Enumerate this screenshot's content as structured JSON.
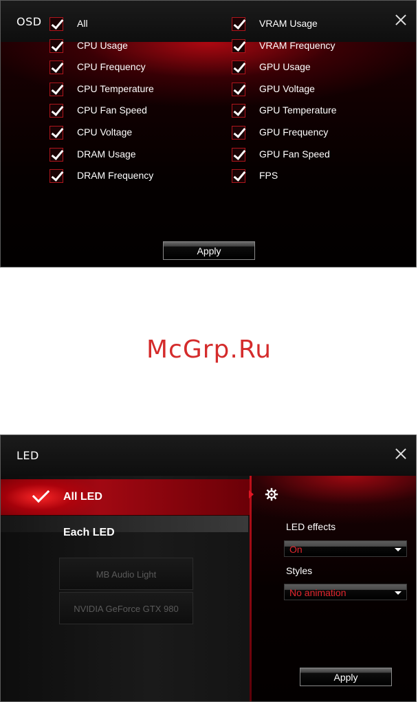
{
  "osd": {
    "title": "OSD",
    "left_items": [
      "All",
      "CPU Usage",
      "CPU Frequency",
      "CPU Temperature",
      "CPU Fan Speed",
      "CPU Voltage",
      "DRAM Usage",
      "DRAM Frequency"
    ],
    "right_items": [
      "VRAM Usage",
      "VRAM Frequency",
      "GPU Usage",
      "GPU Voltage",
      "GPU Temperature",
      "GPU Frequency",
      "GPU Fan Speed",
      "FPS"
    ],
    "all_checked": true,
    "apply_label": "Apply"
  },
  "watermark": "McGrp.Ru",
  "led": {
    "title": "LED",
    "nav": {
      "all_led": "All LED",
      "each_led": "Each LED"
    },
    "devices": [
      "MB Audio Light",
      "NVIDIA GeForce GTX 980"
    ],
    "led_effects_label": "LED effects",
    "led_effects_value": "On",
    "styles_label": "Styles",
    "styles_value": "No animation",
    "apply_label": "Apply"
  },
  "colors": {
    "accent": "#c8101a",
    "select_text": "#e4262e",
    "watermark": "#d42b2b"
  },
  "icons": {
    "close": "close-icon",
    "check": "check-icon",
    "settings": "gear-icon",
    "dropdown": "chevron-down-icon"
  }
}
